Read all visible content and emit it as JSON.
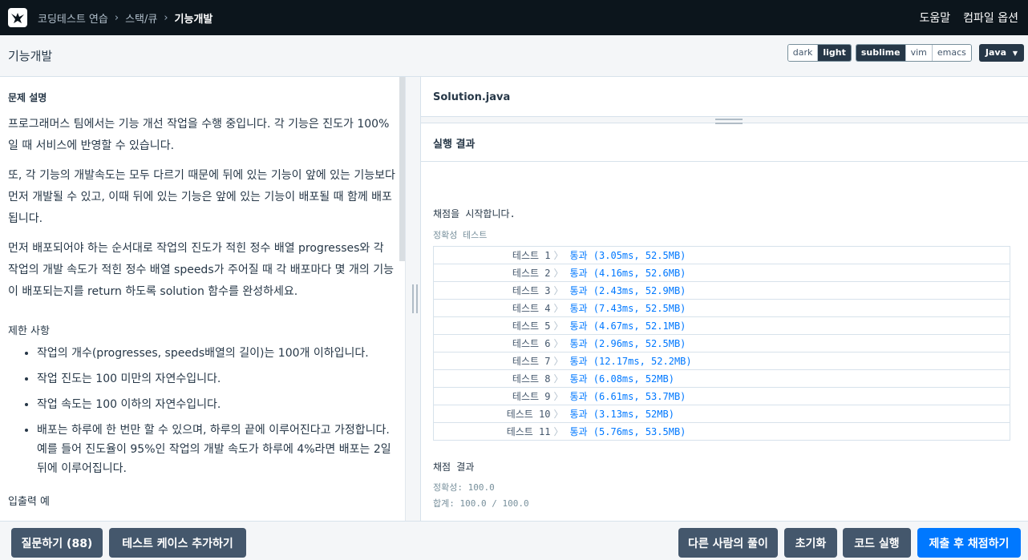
{
  "nav": {
    "breadcrumbs": [
      "코딩테스트 연습",
      "스택/큐",
      "기능개발"
    ],
    "help": "도움말",
    "compile_options": "컴파일 옵션"
  },
  "subbar": {
    "title": "기능개발",
    "themes": [
      "dark",
      "light"
    ],
    "active_theme": "light",
    "keymaps": [
      "sublime",
      "vim",
      "emacs"
    ],
    "active_keymap": "sublime",
    "language": "Java"
  },
  "problem": {
    "section_title": "문제 설명",
    "paragraphs": [
      "프로그래머스 팀에서는 기능 개선 작업을 수행 중입니다. 각 기능은 진도가 100%일 때 서비스에 반영할 수 있습니다.",
      "또, 각 기능의 개발속도는 모두 다르기 때문에 뒤에 있는 기능이 앞에 있는 기능보다 먼저 개발될 수 있고, 이때 뒤에 있는 기능은 앞에 있는 기능이 배포될 때 함께 배포됩니다.",
      "먼저 배포되어야 하는 순서대로 작업의 진도가 적힌 정수 배열 progresses와 각 작업의 개발 속도가 적힌 정수 배열 speeds가 주어질 때 각 배포마다 몇 개의 기능이 배포되는지를 return 하도록 solution 함수를 완성하세요."
    ],
    "constraints_title": "제한 사항",
    "constraints": [
      "작업의 개수(progresses, speeds배열의 길이)는 100개 이하입니다.",
      "작업 진도는 100 미만의 자연수입니다.",
      "작업 속도는 100 이하의 자연수입니다.",
      "배포는 하루에 한 번만 할 수 있으며, 하루의 끝에 이루어진다고 가정합니다. 예를 들어 진도율이 95%인 작업의 개발 속도가 하루에 4%라면 배포는 2일 뒤에 이루어집니다."
    ],
    "io_title": "입출력 예"
  },
  "editor": {
    "filename": "Solution.java"
  },
  "result": {
    "title": "실행 결과",
    "start_msg": "채점을 시작합니다.",
    "header": "정확성  테스트",
    "tests": [
      {
        "name": "테스트 1",
        "result": "통과 (3.05ms, 52.5MB)"
      },
      {
        "name": "테스트 2",
        "result": "통과 (4.16ms, 52.6MB)"
      },
      {
        "name": "테스트 3",
        "result": "통과 (2.43ms, 52.9MB)"
      },
      {
        "name": "테스트 4",
        "result": "통과 (7.43ms, 52.5MB)"
      },
      {
        "name": "테스트 5",
        "result": "통과 (4.67ms, 52.1MB)"
      },
      {
        "name": "테스트 6",
        "result": "통과 (2.96ms, 52.5MB)"
      },
      {
        "name": "테스트 7",
        "result": "통과 (12.17ms, 52.2MB)"
      },
      {
        "name": "테스트 8",
        "result": "통과 (6.08ms, 52MB)"
      },
      {
        "name": "테스트 9",
        "result": "통과 (6.61ms, 53.7MB)"
      },
      {
        "name": "테스트 10",
        "result": "통과 (3.13ms, 52MB)"
      },
      {
        "name": "테스트 11",
        "result": "통과 (5.76ms, 53.5MB)"
      }
    ],
    "arrow": "〉",
    "score_title": "채점 결과",
    "accuracy": "정확성: 100.0",
    "total": "합계: 100.0 / 100.0"
  },
  "bottom": {
    "question": "질문하기 (88)",
    "add_testcase": "테스트 케이스 추가하기",
    "others_solution": "다른 사람의 풀이",
    "reset": "초기화",
    "run": "코드 실행",
    "submit": "제출 후 채점하기"
  },
  "colors": {
    "nav_bg": "#0c151c",
    "primary": "#0078ff",
    "button_dark": "#44576c",
    "pass_text": "#0078ff"
  }
}
